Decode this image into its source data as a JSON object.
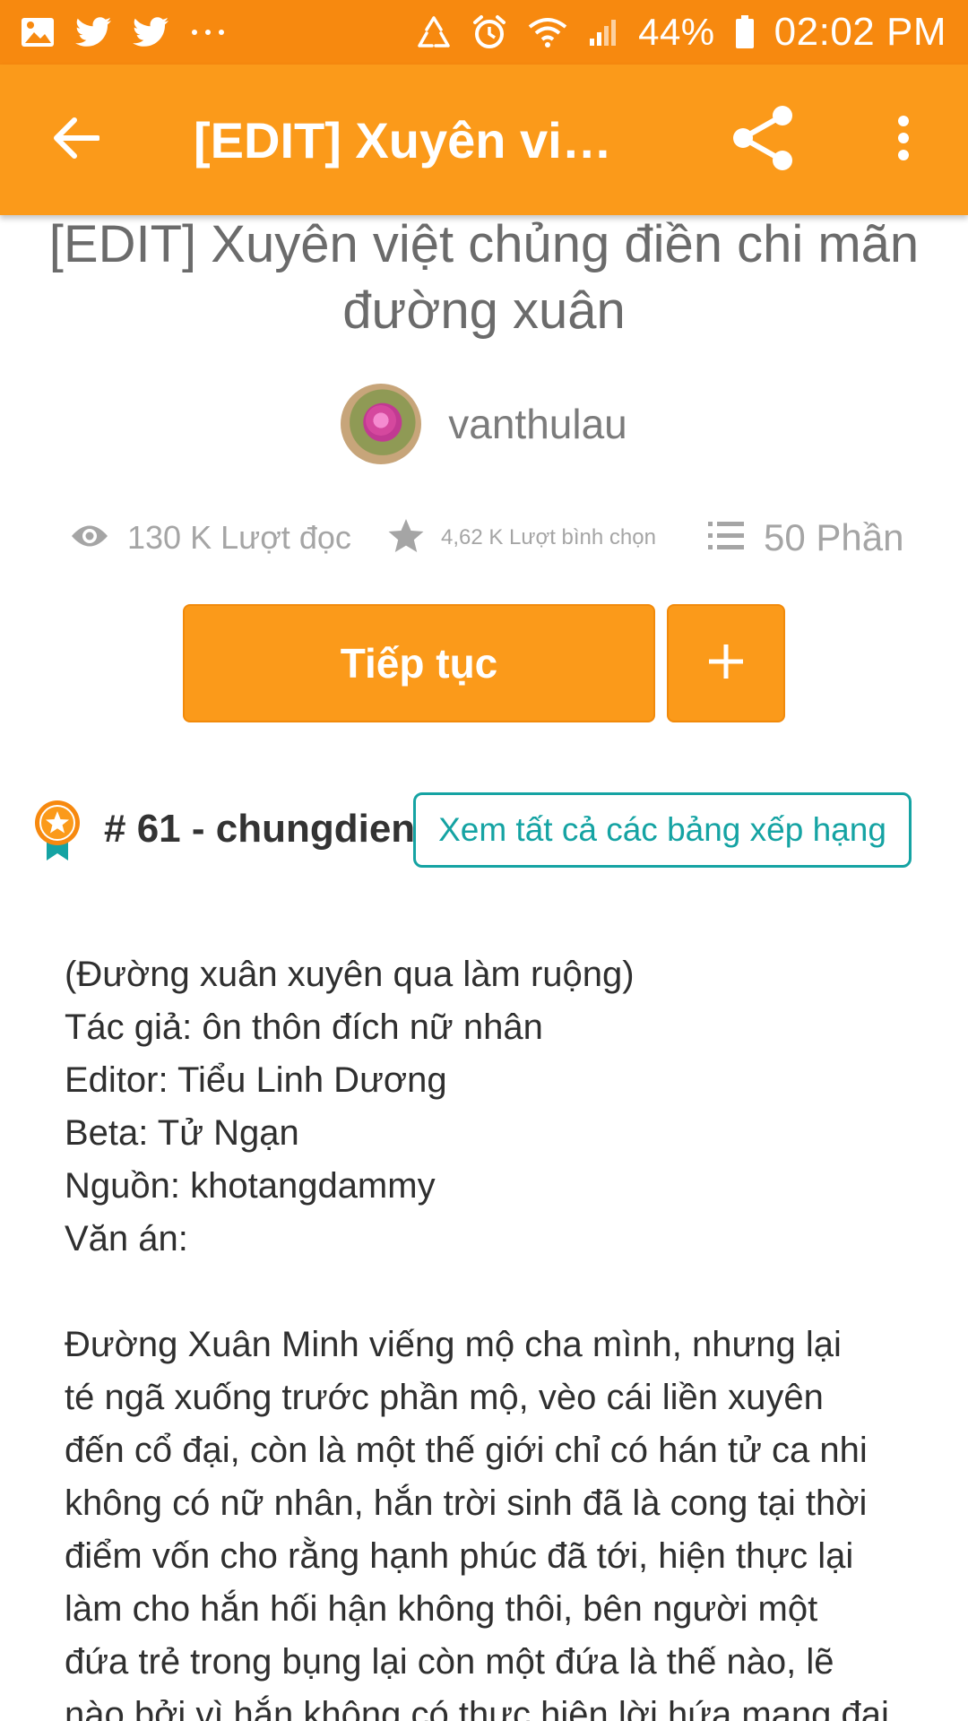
{
  "status_bar": {
    "left_icons": [
      "gallery-icon",
      "twitter-icon",
      "twitter-icon",
      "more-dots-icon"
    ],
    "right_icons": [
      "recycle-icon",
      "alarm-icon",
      "wifi-icon",
      "signal-icon"
    ],
    "battery_percent": "44%",
    "time": "02:02 PM"
  },
  "app_bar": {
    "title": "[EDIT] Xuyên việt…",
    "back_icon": "arrow-left-icon",
    "share_icon": "share-icon",
    "more_icon": "more-vert-icon"
  },
  "story": {
    "title": "[EDIT] Xuyên việt chủng điền chi mãn đường xuân",
    "author": "vanthulau"
  },
  "stats": {
    "reads": "130 K Lượt đọc",
    "votes": "4,62 K Lượt bình chọn",
    "parts": "50 Phần"
  },
  "actions": {
    "continue_label": "Tiếp tục",
    "add_label": "+"
  },
  "ranking": {
    "text": "# 61 - chungdien",
    "view_all_label": "Xem tất cả các bảng xếp hạng"
  },
  "description": {
    "info_lines": [
      "(Đường xuân xuyên qua làm ruộng)",
      "Tác giả: ôn thôn đích nữ nhân",
      "Editor: Tiểu Linh Dương",
      "Beta: Tử Ngạn",
      "Nguồn: khotangdammy",
      "Văn án:"
    ],
    "synopsis_lines": [
      "Đường Xuân Minh viếng mộ cha mình, nhưng lại",
      "té ngã xuống trước phần mộ, vèo cái liền xuyên",
      "đến cổ đại, còn là một thế giới chỉ có hán tử ca nhi",
      "không có nữ nhân, hắn trời sinh đã là cong tại thời",
      "điểm vốn cho rằng hạnh phúc đã tới, hiện thực lại",
      "làm cho hắn hối hận không thôi, bên người một",
      "đứa trẻ trong bụng lại còn một đứa là thế nào, lẽ",
      "nào bởi vì hắn không có thực hiện lời hứa mang đại"
    ]
  },
  "colors": {
    "status_bar": "#f7890f",
    "app_bar": "#fb9a1a",
    "teal": "#15a3a3"
  }
}
